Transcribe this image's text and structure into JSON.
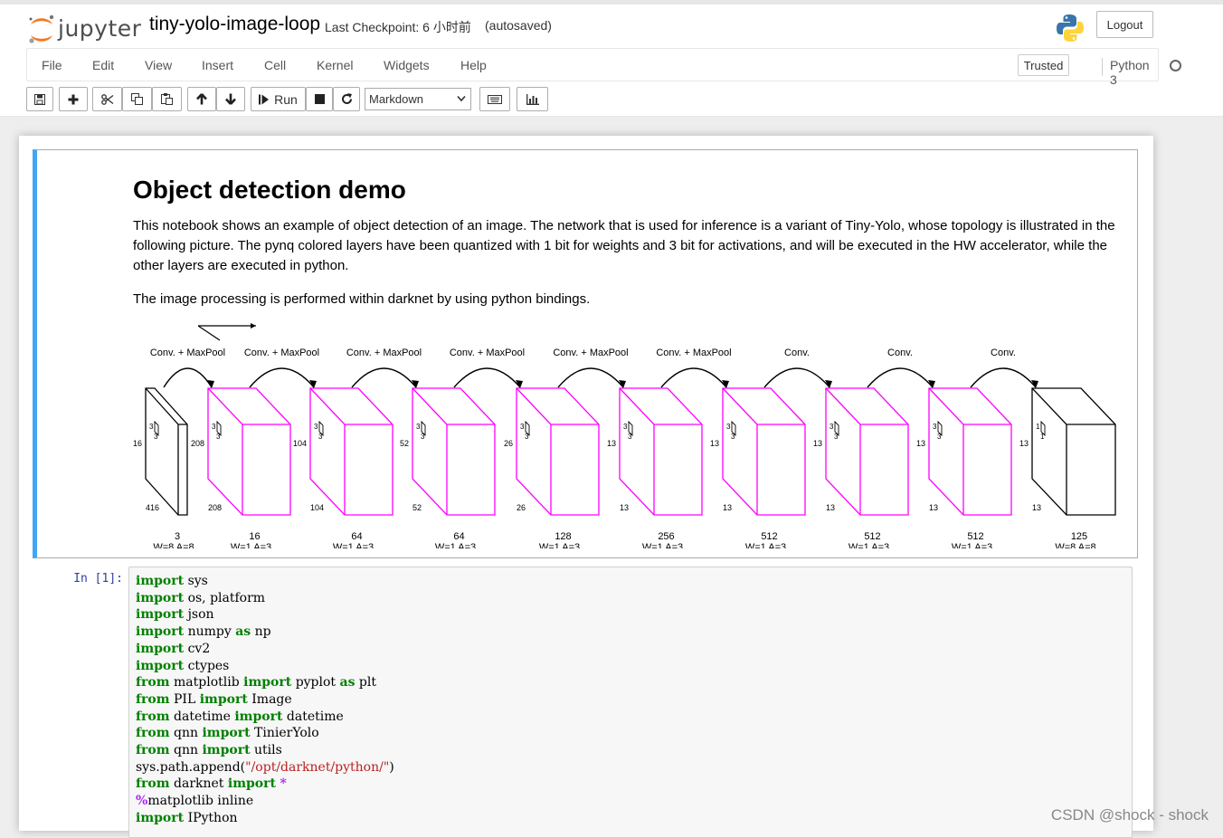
{
  "header": {
    "logo_text": "jupyter",
    "notebook_name": "tiny-yolo-image-loop",
    "checkpoint": "Last Checkpoint: 6 小时前",
    "autosave": "(autosaved)",
    "logout": "Logout"
  },
  "menu": {
    "items": [
      "File",
      "Edit",
      "View",
      "Insert",
      "Cell",
      "Kernel",
      "Widgets",
      "Help"
    ],
    "trusted": "Trusted",
    "kernel_name": "Python 3"
  },
  "toolbar": {
    "run_label": "Run",
    "cell_type": "Markdown",
    "icons": [
      "save-icon",
      "plus-icon",
      "cut-icon",
      "copy-icon",
      "paste-icon",
      "arrow-up-icon",
      "arrow-down-icon",
      "step-forward-icon",
      "stop-icon",
      "refresh-icon",
      "keyboard-icon",
      "bar-chart-icon"
    ]
  },
  "markdown_cell": {
    "title": "Object detection demo",
    "paragraph1": "This notebook shows an example of object detection of an image. The network that is used for inference is a variant of Tiny-Yolo, whose topology is illustrated in the following picture. The pynq colored layers have been quantized with 1 bit for weights and 3 bit for activations, and will be executed in the HW accelerator, while the other layers are executed in python.",
    "paragraph2": "The image processing is performed within darknet by using python bindings.",
    "diagram": {
      "colors": {
        "hw_layer": "#ff00ff",
        "sw_layer": "#000000"
      },
      "ops": [
        "Conv. + MaxPool",
        "Conv. + MaxPool",
        "Conv. + MaxPool",
        "Conv. + MaxPool",
        "Conv. + MaxPool",
        "Conv. + MaxPool",
        "Conv.",
        "Conv.",
        "Conv."
      ],
      "layers": [
        {
          "size": "416",
          "kernel": "3",
          "channels": "3",
          "quant": "W=8 A=8",
          "hw": false
        },
        {
          "size": "208",
          "kernel": "3",
          "channels": "16",
          "quant": "W=1 A=3",
          "hw": true
        },
        {
          "size": "104",
          "kernel": "3",
          "channels": "64",
          "quant": "W=1 A=3",
          "hw": true
        },
        {
          "size": "52",
          "kernel": "3",
          "channels": "64",
          "quant": "W=1 A=3",
          "hw": true
        },
        {
          "size": "26",
          "kernel": "3",
          "channels": "128",
          "quant": "W=1 A=3",
          "hw": true
        },
        {
          "size": "13",
          "kernel": "3",
          "channels": "256",
          "quant": "W=1 A=3",
          "hw": true
        },
        {
          "size": "13",
          "kernel": "3",
          "channels": "512",
          "quant": "W=1 A=3",
          "hw": true
        },
        {
          "size": "13",
          "kernel": "3",
          "channels": "512",
          "quant": "W=1 A=3",
          "hw": true
        },
        {
          "size": "13",
          "kernel": "3",
          "channels": "512",
          "quant": "W=1 A=3",
          "hw": true
        },
        {
          "size": "13",
          "kernel": "1",
          "channels": "125",
          "quant": "W=8 A=8",
          "hw": false
        }
      ]
    }
  },
  "code_cell": {
    "prompt": "In  [1]:",
    "lines": [
      [
        [
          "kw",
          "import"
        ],
        [
          "",
          "sys"
        ]
      ],
      [
        [
          "kw",
          "import"
        ],
        [
          "",
          "os, platform"
        ]
      ],
      [
        [
          "kw",
          "import"
        ],
        [
          "",
          "json"
        ]
      ],
      [
        [
          "kw",
          "import"
        ],
        [
          "",
          "numpy "
        ],
        [
          "kw",
          "as"
        ],
        [
          "",
          "np"
        ]
      ],
      [
        [
          "kw",
          "import"
        ],
        [
          "",
          "cv2"
        ]
      ],
      [
        [
          "kw",
          "import"
        ],
        [
          "",
          "ctypes"
        ]
      ],
      [
        [
          "kw",
          "from"
        ],
        [
          "",
          "matplotlib "
        ],
        [
          "kw",
          "import"
        ],
        [
          "",
          "pyplot "
        ],
        [
          "kw",
          "as"
        ],
        [
          "",
          "plt"
        ]
      ],
      [
        [
          "kw",
          "from"
        ],
        [
          "",
          "PIL "
        ],
        [
          "kw",
          "import"
        ],
        [
          "",
          "Image"
        ]
      ],
      [
        [
          "kw",
          "from"
        ],
        [
          "",
          "datetime "
        ],
        [
          "kw",
          "import"
        ],
        [
          "",
          "datetime"
        ]
      ],
      [
        [
          "kw",
          "from"
        ],
        [
          "",
          "qnn "
        ],
        [
          "kw",
          "import"
        ],
        [
          "",
          "TinierYolo"
        ]
      ],
      [
        [
          "kw",
          "from"
        ],
        [
          "",
          "qnn "
        ],
        [
          "kw",
          "import"
        ],
        [
          "",
          "utils"
        ]
      ],
      [
        [
          "",
          "sys.path.append("
        ],
        [
          "str",
          "\"/opt/darknet/python/\""
        ],
        [
          "",
          ")"
        ]
      ],
      [
        [
          "kw",
          "from"
        ],
        [
          "",
          "darknet "
        ],
        [
          "kw",
          "import"
        ],
        [
          "mg",
          "*"
        ]
      ],
      [
        [
          "mg",
          "%"
        ],
        [
          "",
          "matplotlib inline"
        ]
      ],
      [
        [
          "kw",
          "import"
        ],
        [
          "",
          "IPython"
        ]
      ]
    ]
  },
  "watermark": "CSDN @shock - shock"
}
